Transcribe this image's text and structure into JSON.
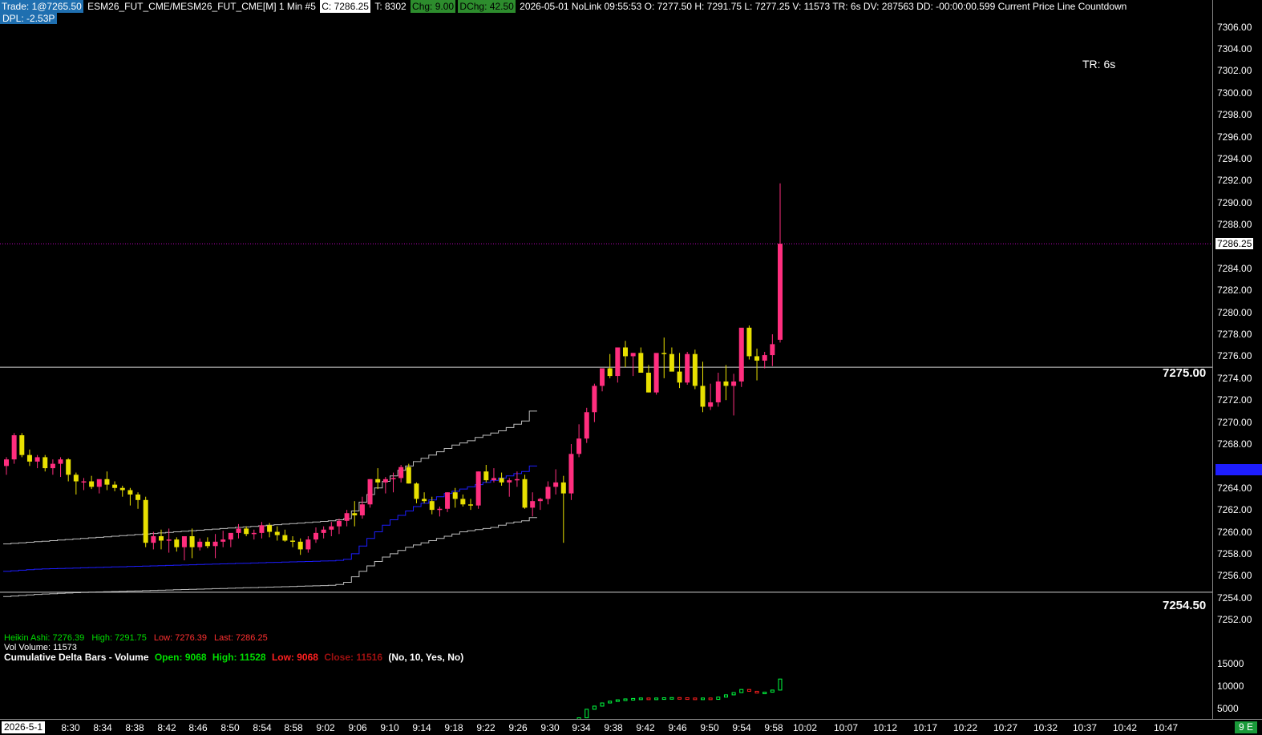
{
  "header": {
    "trade": "Trade: 1@7265.50",
    "symbol": "ESM26_FUT_CME/MESM26_FUT_CME[M]  1 Min  #5",
    "close": "C: 7286.25",
    "ticks": "T: 8302",
    "chg": "Chg: 9.00",
    "dchg": "DChg: 42.50",
    "rest": "2026-05-01 NoLink 09:55:53 O: 7277.50 H: 7291.75 L: 7277.25 V: 11573 TR: 6s DV: 287563 DD: -00:00:00.599 Current Price Line  Countdown",
    "dpl": "DPL: -2.53P"
  },
  "timer": "TR:  6s",
  "lines": {
    "upper": "7275.00",
    "lower": "7254.50"
  },
  "price_axis": {
    "labels": [
      "7306.00",
      "7304.00",
      "7302.00",
      "7300.00",
      "7298.00",
      "7296.00",
      "7294.00",
      "7292.00",
      "7290.00",
      "7288.00",
      "7284.00",
      "7282.00",
      "7280.00",
      "7278.00",
      "7276.00",
      "7274.00",
      "7272.00",
      "7270.00",
      "7268.00",
      "7264.00",
      "7262.00",
      "7260.00",
      "7258.00",
      "7256.00",
      "7254.00",
      "7252.00"
    ],
    "current": "7286.25",
    "vol_labels": [
      "15000",
      "10000",
      "5000"
    ]
  },
  "status": {
    "ha_label": "Heikin Ashi: 7276.39",
    "high": "High: 7291.75",
    "low": "Low: 7276.39",
    "last": "Last: 7286.25",
    "vol": "Vol  Volume: 11573"
  },
  "cumdelta": {
    "title": "Cumulative Delta Bars - Volume",
    "open": "Open: 9068",
    "high": "High: 11528",
    "low": "Low: 9068",
    "close": "Close: 11516",
    "params": "(No, 10, Yes, No)"
  },
  "time_axis": {
    "date": "2026-5-1",
    "labels": [
      "8:30",
      "8:34",
      "8:38",
      "8:42",
      "8:46",
      "8:50",
      "8:54",
      "8:58",
      "9:02",
      "9:06",
      "9:10",
      "9:14",
      "9:18",
      "9:22",
      "9:26",
      "9:30",
      "9:34",
      "9:38",
      "9:42",
      "9:46",
      "9:50",
      "9:54",
      "9:58",
      "10:02",
      "10:07",
      "10:12",
      "10:17",
      "10:22",
      "10:27",
      "10:32",
      "10:37",
      "10:42",
      "10:47"
    ],
    "badge": "9 E"
  },
  "colors": {
    "up": "#ff2e7e",
    "down": "#e8e000",
    "blue_band": "#1d1dff",
    "band": "#bdbdbd",
    "price_line": "#c000c0"
  },
  "chart_data": {
    "type": "candlestick",
    "bars": [
      [
        7266.0,
        7266.8,
        7265.2,
        7266.6
      ],
      [
        7266.6,
        7269.0,
        7266.2,
        7268.8
      ],
      [
        7268.8,
        7269.0,
        7266.8,
        7267.0
      ],
      [
        7267.0,
        7267.5,
        7266.0,
        7266.4
      ],
      [
        7266.4,
        7267.0,
        7265.8,
        7266.8
      ],
      [
        7266.8,
        7267.0,
        7265.5,
        7265.8
      ],
      [
        7265.8,
        7266.6,
        7265.2,
        7266.2
      ],
      [
        7266.2,
        7266.8,
        7265.0,
        7266.6
      ],
      [
        7266.6,
        7266.7,
        7264.6,
        7265.2
      ],
      [
        7265.2,
        7265.4,
        7263.4,
        7264.6
      ],
      [
        7264.6,
        7264.9,
        7263.8,
        7264.6
      ],
      [
        7264.6,
        7265.1,
        7263.9,
        7264.1
      ],
      [
        7264.1,
        7264.6,
        7263.5,
        7264.8
      ],
      [
        7264.8,
        7265.5,
        7263.8,
        7264.3
      ],
      [
        7264.3,
        7264.6,
        7263.7,
        7264.0
      ],
      [
        7264.0,
        7264.2,
        7263.2,
        7263.8
      ],
      [
        7263.8,
        7264.0,
        7262.4,
        7263.4
      ],
      [
        7263.4,
        7263.6,
        7262.1,
        7262.9
      ],
      [
        7262.9,
        7263.2,
        7258.6,
        7259.0
      ],
      [
        7259.0,
        7260.0,
        7258.4,
        7259.6
      ],
      [
        7259.6,
        7260.2,
        7258.4,
        7259.2
      ],
      [
        7259.2,
        7260.3,
        7258.1,
        7259.3
      ],
      [
        7259.3,
        7259.5,
        7258.2,
        7258.6
      ],
      [
        7258.6,
        7259.6,
        7257.4,
        7259.6
      ],
      [
        7259.6,
        7260.3,
        7257.6,
        7258.6
      ],
      [
        7258.6,
        7259.4,
        7258.3,
        7259.1
      ],
      [
        7259.1,
        7259.5,
        7258.5,
        7258.7
      ],
      [
        7258.7,
        7259.8,
        7257.6,
        7259.1
      ],
      [
        7259.1,
        7260.1,
        7258.6,
        7259.3
      ],
      [
        7259.3,
        7259.5,
        7258.6,
        7259.9
      ],
      [
        7259.9,
        7260.7,
        7259.4,
        7260.3
      ],
      [
        7260.3,
        7260.5,
        7259.6,
        7259.8
      ],
      [
        7259.8,
        7260.2,
        7259.3,
        7259.9
      ],
      [
        7259.9,
        7260.9,
        7259.4,
        7260.6
      ],
      [
        7260.6,
        7260.8,
        7259.5,
        7260.0
      ],
      [
        7260.0,
        7260.5,
        7259.2,
        7259.7
      ],
      [
        7259.7,
        7260.2,
        7259.1,
        7259.2
      ],
      [
        7259.2,
        7259.6,
        7258.6,
        7259.1
      ],
      [
        7259.1,
        7259.4,
        7257.9,
        7258.4
      ],
      [
        7258.4,
        7259.6,
        7258.1,
        7259.3
      ],
      [
        7259.3,
        7260.4,
        7259.0,
        7259.9
      ],
      [
        7259.9,
        7260.5,
        7259.4,
        7260.2
      ],
      [
        7260.2,
        7260.9,
        7259.6,
        7260.5
      ],
      [
        7260.5,
        7261.2,
        7259.8,
        7261.0
      ],
      [
        7261.0,
        7262.0,
        7260.5,
        7261.7
      ],
      [
        7261.7,
        7262.8,
        7260.5,
        7261.5
      ],
      [
        7261.5,
        7263.2,
        7261.2,
        7262.5
      ],
      [
        7262.5,
        7264.8,
        7262.2,
        7264.8
      ],
      [
        7264.8,
        7265.8,
        7263.9,
        7264.5
      ],
      [
        7264.5,
        7265.0,
        7263.5,
        7264.8
      ],
      [
        7264.8,
        7265.4,
        7263.6,
        7264.9
      ],
      [
        7264.9,
        7266.1,
        7264.5,
        7265.9
      ],
      [
        7265.9,
        7266.2,
        7264.4,
        7264.4
      ],
      [
        7264.4,
        7264.5,
        7262.6,
        7263.0
      ],
      [
        7263.0,
        7263.6,
        7262.6,
        7262.8
      ],
      [
        7262.8,
        7263.2,
        7261.6,
        7262.0
      ],
      [
        7262.0,
        7262.3,
        7261.4,
        7262.1
      ],
      [
        7262.1,
        7263.6,
        7261.8,
        7263.6
      ],
      [
        7263.6,
        7264.0,
        7262.2,
        7263.0
      ],
      [
        7263.0,
        7263.4,
        7262.3,
        7262.5
      ],
      [
        7262.5,
        7263.0,
        7262.0,
        7262.4
      ],
      [
        7262.4,
        7265.5,
        7262.1,
        7265.5
      ],
      [
        7265.5,
        7266.1,
        7264.5,
        7264.7
      ],
      [
        7264.7,
        7265.8,
        7264.5,
        7264.9
      ],
      [
        7264.9,
        7265.4,
        7264.2,
        7264.5
      ],
      [
        7264.5,
        7264.9,
        7263.2,
        7264.7
      ],
      [
        7264.7,
        7265.5,
        7264.1,
        7264.8
      ],
      [
        7264.8,
        7265.2,
        7262.1,
        7262.2
      ],
      [
        7262.2,
        7263.6,
        7261.4,
        7262.8
      ],
      [
        7262.8,
        7263.1,
        7262.0,
        7263.0
      ],
      [
        7263.0,
        7264.6,
        7262.5,
        7264.1
      ],
      [
        7264.1,
        7265.7,
        7263.4,
        7264.5
      ],
      [
        7264.5,
        7265.1,
        7259.0,
        7263.5
      ],
      [
        7263.5,
        7268.0,
        7262.9,
        7267.1
      ],
      [
        7267.1,
        7269.8,
        7266.8,
        7268.5
      ],
      [
        7268.5,
        7271.3,
        7268.1,
        7270.9
      ],
      [
        7270.9,
        7273.5,
        7270.0,
        7273.3
      ],
      [
        7273.3,
        7274.3,
        7272.8,
        7274.9
      ],
      [
        7274.9,
        7276.2,
        7274.0,
        7274.2
      ],
      [
        7274.2,
        7276.7,
        7273.6,
        7276.8
      ],
      [
        7276.8,
        7277.4,
        7275.0,
        7276.0
      ],
      [
        7276.0,
        7276.3,
        7274.2,
        7276.3
      ],
      [
        7276.3,
        7276.8,
        7274.5,
        7274.5
      ],
      [
        7274.5,
        7275.2,
        7272.7,
        7272.7
      ],
      [
        7272.7,
        7276.2,
        7272.5,
        7276.3
      ],
      [
        7276.3,
        7277.7,
        7274.0,
        7276.2
      ],
      [
        7276.2,
        7276.8,
        7274.7,
        7274.6
      ],
      [
        7274.6,
        7276.3,
        7273.1,
        7273.6
      ],
      [
        7273.6,
        7276.4,
        7273.4,
        7276.2
      ],
      [
        7276.2,
        7276.6,
        7273.0,
        7273.3
      ],
      [
        7273.3,
        7275.5,
        7270.9,
        7271.4
      ],
      [
        7271.4,
        7273.5,
        7271.1,
        7271.8
      ],
      [
        7271.8,
        7274.5,
        7271.4,
        7273.7
      ],
      [
        7273.7,
        7275.2,
        7272.0,
        7273.3
      ],
      [
        7273.3,
        7274.4,
        7270.6,
        7273.7
      ],
      [
        7273.7,
        7278.5,
        7273.2,
        7278.6
      ],
      [
        7278.6,
        7278.8,
        7275.7,
        7276.0
      ],
      [
        7276.0,
        7276.7,
        7273.8,
        7275.6
      ],
      [
        7275.6,
        7276.4,
        7274.9,
        7276.1
      ],
      [
        7276.1,
        7278.0,
        7275.1,
        7277.1
      ],
      [
        7277.5,
        7291.75,
        7277.25,
        7286.25
      ]
    ],
    "upper_band": [
      7258.9,
      7258.95,
      7259.0,
      7259.05,
      7259.1,
      7259.15,
      7259.2,
      7259.25,
      7259.3,
      7259.35,
      7259.4,
      7259.45,
      7259.5,
      7259.55,
      7259.6,
      7259.65,
      7259.7,
      7259.75,
      7259.8,
      7259.85,
      7259.9,
      7259.95,
      7260.0,
      7260.05,
      7260.1,
      7260.15,
      7260.2,
      7260.25,
      7260.3,
      7260.35,
      7260.4,
      7260.45,
      7260.5,
      7260.55,
      7260.6,
      7260.65,
      7260.7,
      7260.75,
      7260.8,
      7260.85,
      7260.9,
      7260.95,
      7261.0,
      7261.1,
      7261.2,
      7261.9,
      7262.7,
      7263.4,
      7264.0,
      7264.6,
      7265.1,
      7265.6,
      7266.0,
      7266.4,
      7266.7,
      7267.0,
      7267.3,
      7267.6,
      7267.9,
      7268.1,
      7268.3,
      7268.6,
      7268.8,
      7269.0,
      7269.2,
      7269.5,
      7269.8,
      7270.1,
      7271.0
    ],
    "mid_band": [
      7256.4,
      7256.45,
      7256.5,
      7256.55,
      7256.6,
      7256.62,
      7256.64,
      7256.66,
      7256.68,
      7256.7,
      7256.72,
      7256.74,
      7256.76,
      7256.78,
      7256.8,
      7256.82,
      7256.84,
      7256.86,
      7256.88,
      7256.9,
      7256.92,
      7256.94,
      7256.96,
      7256.98,
      7257.0,
      7257.02,
      7257.04,
      7257.06,
      7257.08,
      7257.1,
      7257.12,
      7257.14,
      7257.16,
      7257.18,
      7257.2,
      7257.22,
      7257.24,
      7257.26,
      7257.28,
      7257.3,
      7257.32,
      7257.34,
      7257.36,
      7257.4,
      7257.5,
      7258.0,
      7258.7,
      7259.4,
      7260.0,
      7260.6,
      7261.1,
      7261.5,
      7261.9,
      7262.3,
      7262.6,
      7262.9,
      7263.2,
      7263.5,
      7263.7,
      7263.9,
      7264.1,
      7264.3,
      7264.5,
      7264.7,
      7264.9,
      7265.1,
      7265.3,
      7265.5,
      7266.0
    ],
    "lower_band": [
      7254.1,
      7254.15,
      7254.2,
      7254.25,
      7254.3,
      7254.33,
      7254.36,
      7254.39,
      7254.42,
      7254.45,
      7254.48,
      7254.5,
      7254.52,
      7254.54,
      7254.56,
      7254.58,
      7254.6,
      7254.62,
      7254.64,
      7254.66,
      7254.68,
      7254.7,
      7254.72,
      7254.74,
      7254.76,
      7254.78,
      7254.8,
      7254.82,
      7254.84,
      7254.86,
      7254.88,
      7254.9,
      7254.92,
      7254.94,
      7254.96,
      7254.98,
      7255.0,
      7255.02,
      7255.04,
      7255.06,
      7255.08,
      7255.1,
      7255.12,
      7255.2,
      7255.4,
      7255.9,
      7256.4,
      7256.9,
      7257.3,
      7257.7,
      7258.0,
      7258.3,
      7258.6,
      7258.8,
      7259.0,
      7259.2,
      7259.4,
      7259.6,
      7259.8,
      7260.0,
      7260.1,
      7260.2,
      7260.3,
      7260.4,
      7260.6,
      7260.8,
      7260.9,
      7261.0,
      7261.3
    ],
    "band_step": 1,
    "cum_delta": [
      2100,
      2900,
      4800,
      5500,
      6200,
      6600,
      6900,
      7100,
      7200,
      7300,
      7250,
      7300,
      7350,
      7400,
      7350,
      7300,
      7200,
      7300,
      7000,
      7500,
      8000,
      8500,
      9200,
      8800,
      8400,
      8600,
      9068,
      11516
    ],
    "price_ylim": [
      7251.2,
      7307.0
    ],
    "vol_ylim": [
      3000,
      16000
    ],
    "ylabel": ""
  }
}
